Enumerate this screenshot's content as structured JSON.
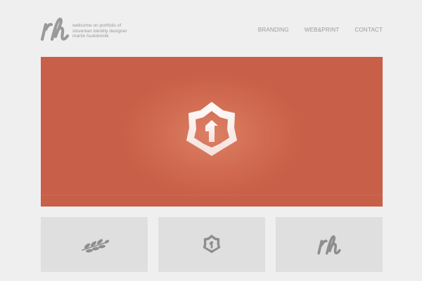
{
  "header": {
    "logo_text": "rh",
    "tagline": [
      "wellcome on portfolio of",
      "slovenian identity designer",
      "martin hudobivnik"
    ]
  },
  "nav": {
    "items": [
      {
        "label": "BRANDING"
      },
      {
        "label": "WEB&PRINT"
      },
      {
        "label": "CONTACT"
      }
    ]
  },
  "hero": {
    "background_color": "#c85f48",
    "emblem_icon": "shield-arrow-emblem-icon"
  },
  "thumbnails": [
    {
      "icon": "laurel-branch-icon"
    },
    {
      "icon": "shield-arrow-emblem-icon"
    },
    {
      "icon": "rh-monogram-icon",
      "logo_text": "rh"
    }
  ],
  "colors": {
    "page_background": "#efefef",
    "hero": "#c85f48",
    "thumbnail_background": "#dfdfdf",
    "nav_text": "#9b9b9b",
    "icon_gray": "#8e8e8e"
  }
}
